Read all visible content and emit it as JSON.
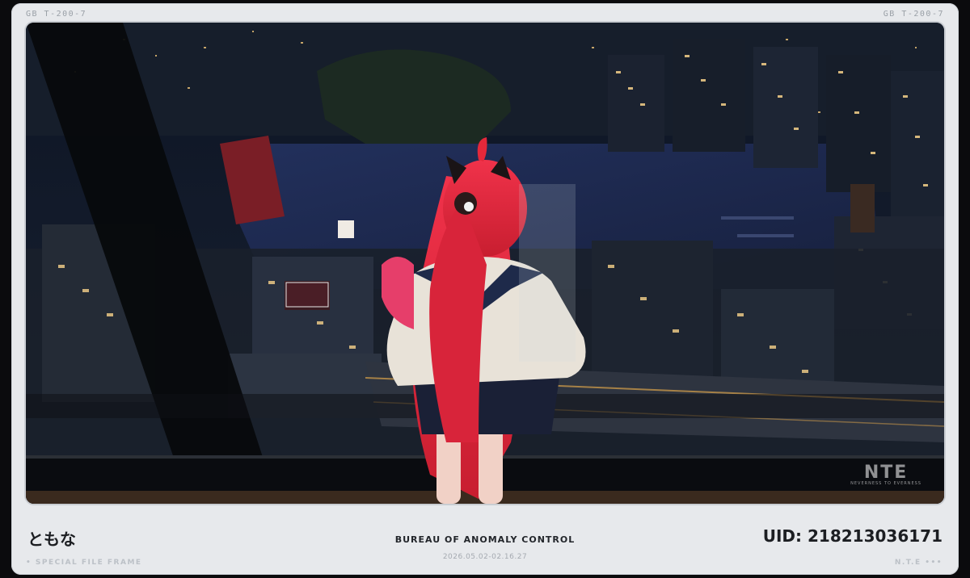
{
  "frame": {
    "corner_left": "GB   T-200-7",
    "corner_right": "GB   T-200-7",
    "logo_text": "NTE",
    "logo_subtext": "NEVERNESS TO EVERNESS"
  },
  "footer": {
    "player_name": "ともな",
    "bureau": "BUREAU OF ANOMALY CONTROL",
    "uid": "UID: 218213036171",
    "timestamp": "2026.05.02-02.16.27",
    "left_caption": "• SPECIAL FILE FRAME",
    "right_caption": "N.T.E •••"
  },
  "colors": {
    "card": "#e7e9ec",
    "night_sky": "#0d1420",
    "river": "#1f2c55",
    "hair": "#e5283a",
    "sweater": "#e8e2d8",
    "skirt": "#1a2036"
  }
}
